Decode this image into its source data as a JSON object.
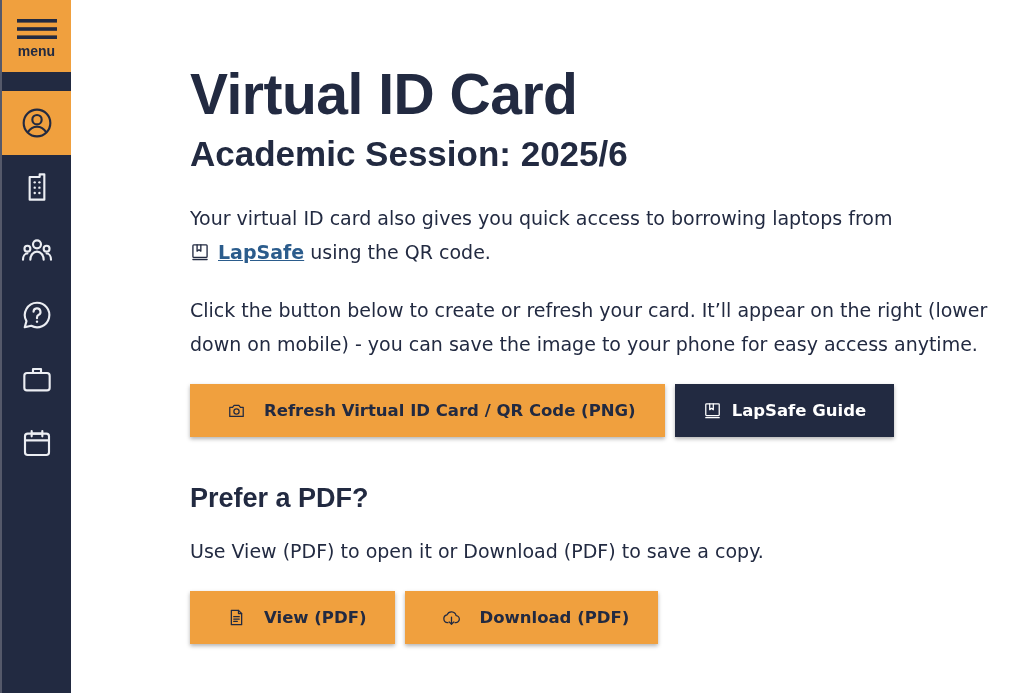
{
  "sidebar": {
    "menu_button": {
      "label": "menu"
    },
    "items": [
      {
        "selected": true
      },
      {
        "selected": false
      },
      {
        "selected": false
      },
      {
        "selected": false
      },
      {
        "selected": false
      },
      {
        "selected": false
      }
    ]
  },
  "header": {
    "title": "Virtual ID Card",
    "subtitle": "Academic Session: 2025/6"
  },
  "intro": {
    "text": "Your virtual ID card also gives you quick access to borrowing laptops from",
    "link": "LapSafe",
    "text_after": "using the QR code."
  },
  "instructions": "Click the button below to create or refresh your card. It’ll appear on the right (lower down on mobile) - you can save the image to your phone for easy access anytime.",
  "card_actions": [
    {
      "label": "Refresh Virtual ID Card / QR Code (PNG)",
      "kind": "primary"
    },
    {
      "label": "LapSafe Guide",
      "kind": "dark"
    }
  ],
  "pdf_section": {
    "heading": "Prefer a PDF?",
    "text": "Use View (PDF) to open it or Download (PDF) to save a copy.",
    "actions": [
      {
        "label": "View (PDF)",
        "kind": "primary"
      },
      {
        "label": "Download (PDF)",
        "kind": "primary"
      }
    ]
  }
}
